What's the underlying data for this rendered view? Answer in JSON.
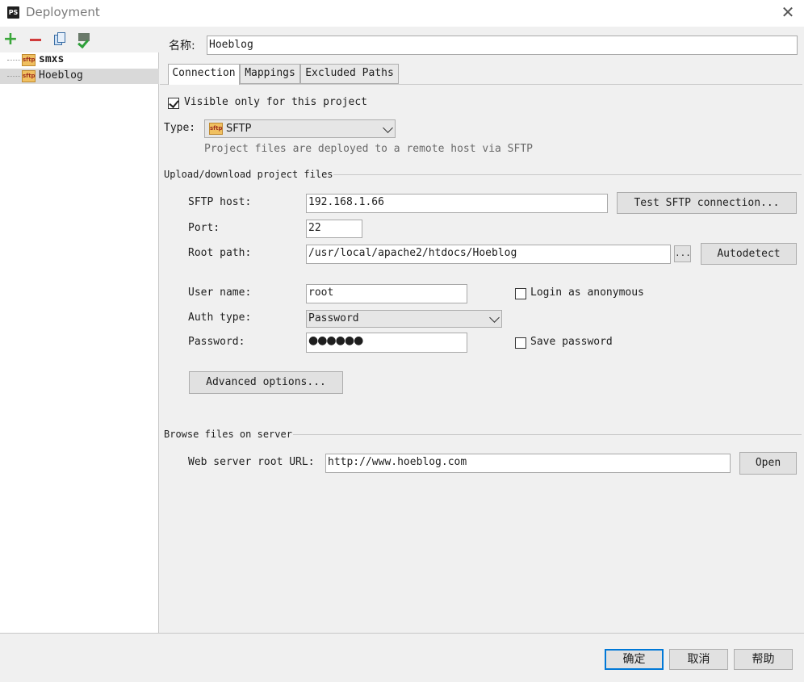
{
  "window": {
    "title": "Deployment",
    "app_icon": "PS"
  },
  "toolbar": {
    "icons": [
      "add-icon",
      "remove-icon",
      "copy-icon",
      "set-default-icon"
    ]
  },
  "servers": [
    {
      "name": "smxs",
      "type_icon": "sftp",
      "bold": true
    },
    {
      "name": "Hoeblog",
      "type_icon": "sftp",
      "selected": true
    }
  ],
  "name_field": {
    "label": "名称:",
    "value": "Hoeblog"
  },
  "tabs": [
    {
      "label": "Connection",
      "active": true
    },
    {
      "label": "Mappings"
    },
    {
      "label": "Excluded Paths"
    }
  ],
  "connection": {
    "visible_only_label": "Visible only for this project",
    "visible_only_checked": true,
    "type_label": "Type:",
    "type_value": "SFTP",
    "type_icon": "sftp",
    "type_hint": "Project files are deployed to a remote host via SFTP",
    "upload_section": "Upload/download project files",
    "host_label": "SFTP host:",
    "host_value": "192.168.1.66",
    "test_button": "Test SFTP connection...",
    "port_label": "Port:",
    "port_value": "22",
    "root_label": "Root path:",
    "root_value": "/usr/local/apache2/htdocs/Hoeblog",
    "browse_button": "...",
    "autodetect_button": "Autodetect",
    "user_label": "User name:",
    "user_value": "root",
    "anonymous_label": "Login as anonymous",
    "anonymous_checked": false,
    "auth_label": "Auth type:",
    "auth_value": "Password",
    "password_label": "Password:",
    "password_value": "●●●●●●",
    "save_password_label": "Save password",
    "save_password_checked": false,
    "advanced_button": "Advanced options...",
    "browse_section": "Browse files on server",
    "web_url_label": "Web server root URL:",
    "web_url_value": "http://www.hoeblog.com",
    "open_button": "Open"
  },
  "dialog_buttons": {
    "ok": "确定",
    "cancel": "取消",
    "help": "帮助"
  },
  "colors": {
    "accent": "#0078d7",
    "add": "#3aa63a",
    "remove": "#d03a3a",
    "selection": "#d9d9d9"
  }
}
